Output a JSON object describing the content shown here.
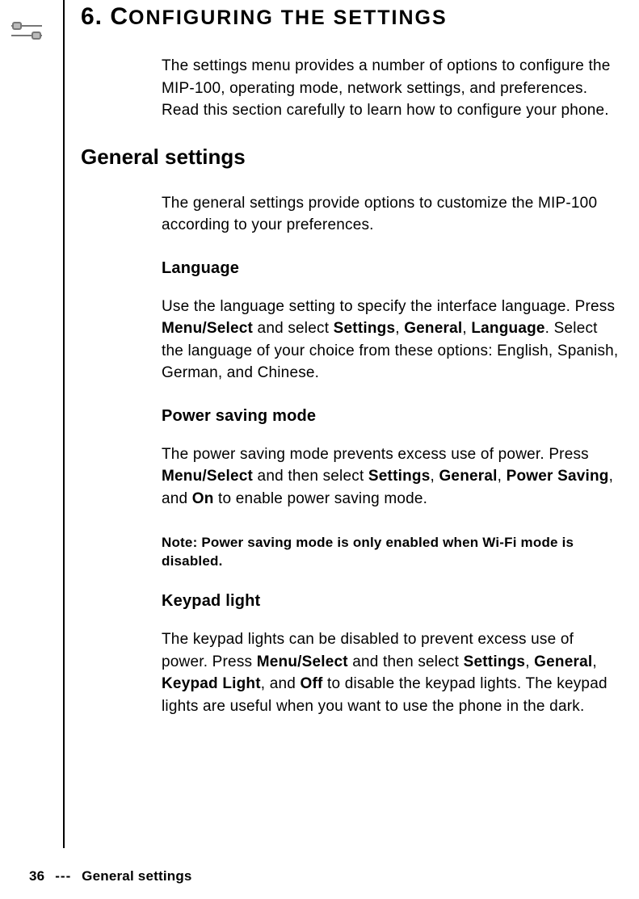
{
  "chapter": {
    "number": "6.",
    "letter": "C",
    "rest": "ONFIGURING THE SETTINGS"
  },
  "intro": "The settings menu provides a number of options to con­figure the MIP-100, operating mode, network settings, and preferences. Read this section carefully to learn how to configure your phone.",
  "general": {
    "heading": "General settings",
    "intro": "The general settings provide options to customize the MIP-100 according to your preferences.",
    "language": {
      "heading": "Language",
      "pre": "Use the language setting to specify the interface lan­guage. Press ",
      "b1": "Menu/Select",
      "mid1": " and select ",
      "b2": "Settings",
      "sep1": ", ",
      "b3": "General",
      "sep2": ", ",
      "b4": "Language",
      "post": ". Select the language of your choice from these options: English, Spanish, German, and Chinese."
    },
    "power": {
      "heading": "Power saving mode",
      "pre": "The power saving mode prevents excess use of power. Press ",
      "b1": "Menu/Select",
      "mid1": " and then select ",
      "b2": "Settings",
      "sep1": ", ",
      "b3": "General",
      "sep2": ", ",
      "b4": "Power Saving",
      "sep3": ", and ",
      "b5": "On",
      "post": " to enable power saving mode.",
      "note": "Note: Power saving mode is only enabled when Wi-Fi mode is disabled."
    },
    "keypad": {
      "heading": "Keypad light",
      "pre": "The keypad lights can be disabled to prevent excess use of power. Press ",
      "b1": "Menu/Select",
      "mid1": " and then select ",
      "b2": "Settings",
      "sep1": ", ",
      "b3": "General",
      "sep2": ", ",
      "b4": "Keypad Light",
      "sep3": ", and ",
      "b5": "Off",
      "post": " to disable the keypad lights. The keypad lights are useful when you want to use the phone in the dark."
    }
  },
  "footer": {
    "page": "36",
    "dash": "---",
    "section": "General settings"
  }
}
